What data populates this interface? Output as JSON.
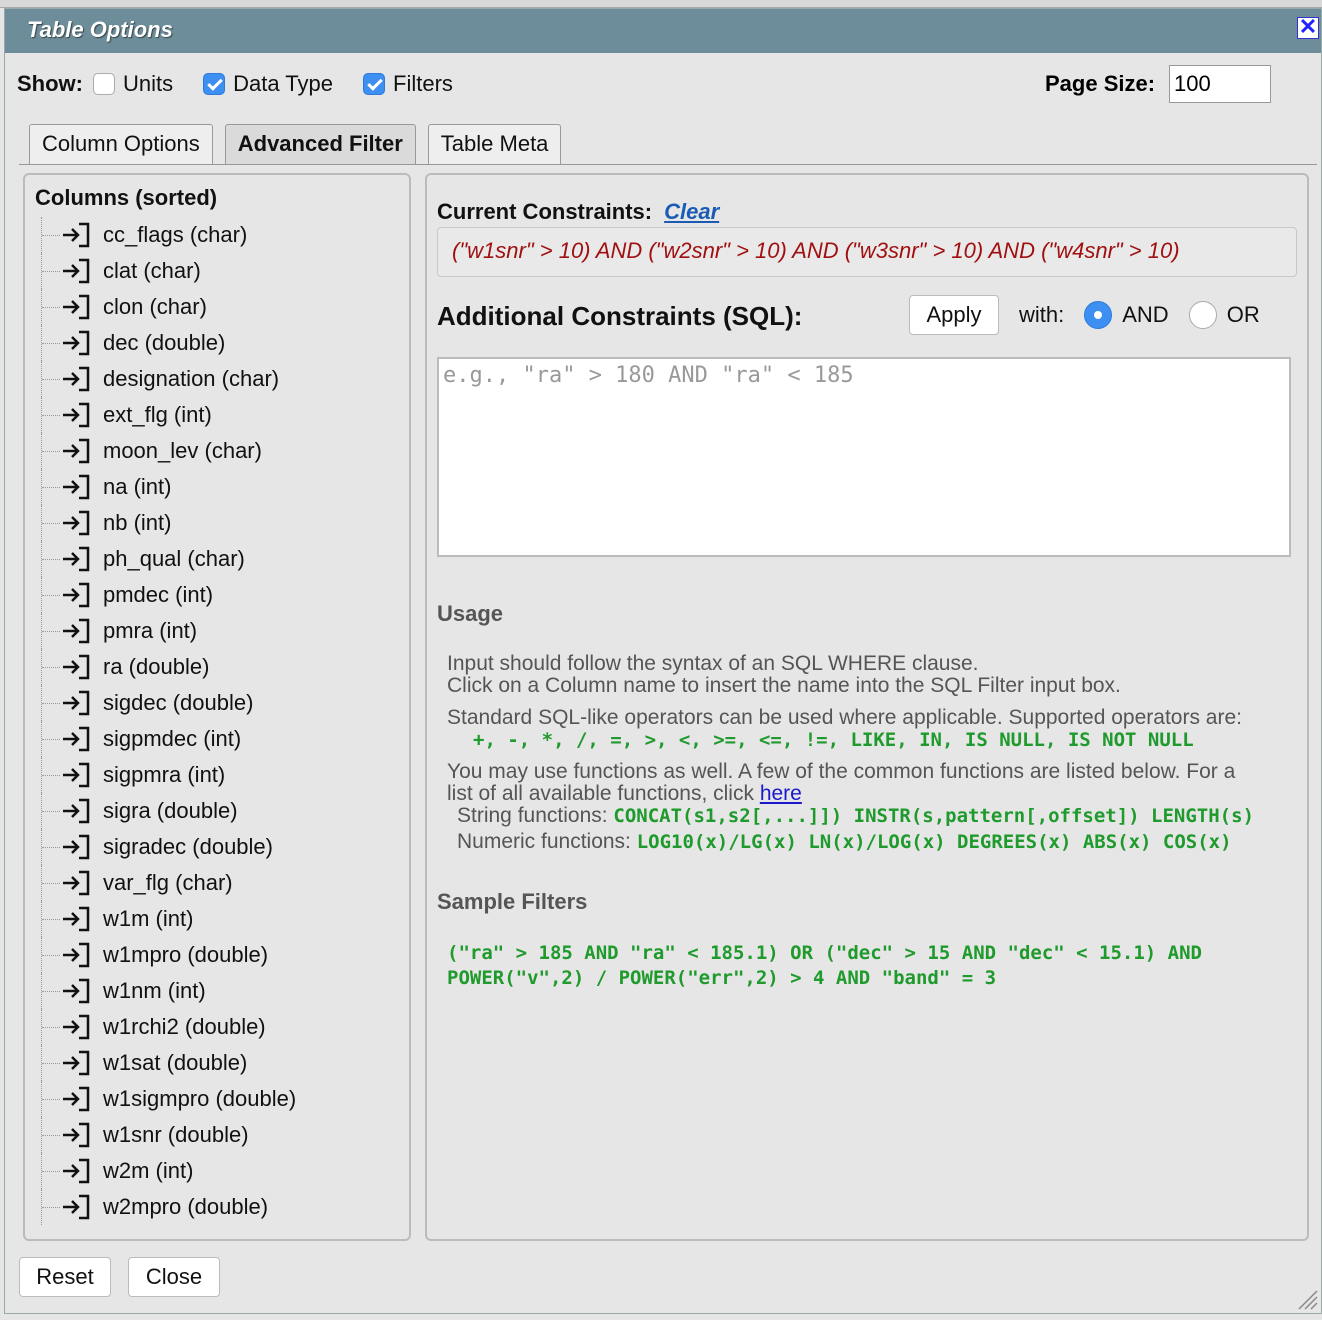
{
  "dialog": {
    "title": "Table Options",
    "close_symbol": "✕"
  },
  "show": {
    "label": "Show:",
    "options": [
      {
        "label": "Units",
        "checked": false
      },
      {
        "label": "Data Type",
        "checked": true
      },
      {
        "label": "Filters",
        "checked": true
      }
    ]
  },
  "page_size": {
    "label": "Page Size:",
    "value": "100"
  },
  "tabs": [
    {
      "label": "Column Options",
      "active": false
    },
    {
      "label": "Advanced Filter",
      "active": true
    },
    {
      "label": "Table Meta",
      "active": false
    }
  ],
  "columns": {
    "heading": "Columns (sorted)",
    "items": [
      "cc_flags (char)",
      "clat (char)",
      "clon (char)",
      "dec (double)",
      "designation (char)",
      "ext_flg (int)",
      "moon_lev (char)",
      "na (int)",
      "nb (int)",
      "ph_qual (char)",
      "pmdec (int)",
      "pmra (int)",
      "ra (double)",
      "sigdec (double)",
      "sigpmdec (int)",
      "sigpmra (int)",
      "sigra (double)",
      "sigradec (double)",
      "var_flg (char)",
      "w1m (int)",
      "w1mpro (double)",
      "w1nm (int)",
      "w1rchi2 (double)",
      "w1sat (double)",
      "w1sigmpro (double)",
      "w1snr (double)",
      "w2m (int)",
      "w2mpro (double)"
    ]
  },
  "filter": {
    "current_label": "Current Constraints:",
    "clear_label": "Clear",
    "current_constraints": "(\"w1snr\" > 10) AND (\"w2snr\" > 10) AND (\"w3snr\" > 10) AND (\"w4snr\" > 10)",
    "additional_label": "Additional Constraints (SQL):",
    "apply_label": "Apply",
    "with_label": "with:",
    "and_label": "AND",
    "or_label": "OR",
    "selected_join": "AND",
    "sql_value": "",
    "sql_placeholder": "e.g., \"ra\" > 180 AND \"ra\" < 185"
  },
  "usage": {
    "heading": "Usage",
    "line1": "Input should follow the syntax of an SQL WHERE clause.",
    "line2": "Click on a Column name to insert the name into the SQL Filter input box.",
    "line3": "Standard SQL-like operators can be used where applicable. Supported operators are:",
    "operators": "+, -, *, /, =, >, <, >=, <=, !=, LIKE, IN, IS NULL, IS NOT NULL",
    "line4": "You may use functions as well. A few of the common functions are listed below. For a",
    "line5_prefix": "list of all available functions, click ",
    "here_link": "here",
    "string_label": "String functions: ",
    "string_funcs": "CONCAT(s1,s2[,...]]) INSTR(s,pattern[,offset]) LENGTH(s)",
    "numeric_label": "Numeric functions: ",
    "numeric_funcs": "LOG10(x)/LG(x) LN(x)/LOG(x) DEGREES(x) ABS(x) COS(x)"
  },
  "samples": {
    "heading": "Sample Filters",
    "line1": "(\"ra\" > 185 AND \"ra\" < 185.1) OR (\"dec\" > 15 AND \"dec\" < 15.1) AND",
    "line2": "POWER(\"v\",2) / POWER(\"err\",2) > 4 AND \"band\" = 3"
  },
  "footer": {
    "reset_label": "Reset",
    "close_label": "Close"
  },
  "colors": {
    "title_bar": "#6d8d9b",
    "accent": "#3d8ff2",
    "constraint_text": "#a01010",
    "code_green": "#1f9a2c"
  }
}
